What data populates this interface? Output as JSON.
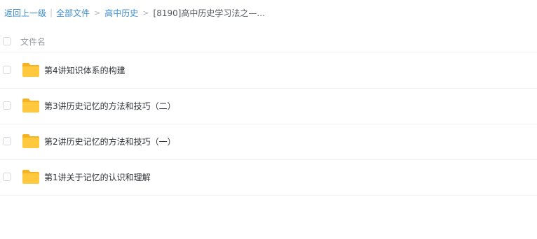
{
  "breadcrumb": {
    "back_label": "返回上一级",
    "separator": "|",
    "all_files_label": "全部文件",
    "arrow": ">",
    "level1_label": "高中历史",
    "current_label": "[8190]高中历史学习法之—..."
  },
  "table": {
    "column_name_header": "文件名",
    "rows": [
      {
        "name": "第4讲知识体系的构建",
        "icon": "folder-icon"
      },
      {
        "name": "第3讲历史记忆的方法和技巧（二）",
        "icon": "folder-icon"
      },
      {
        "name": "第2讲历史记忆的方法和技巧（一）",
        "icon": "folder-icon"
      },
      {
        "name": "第1讲关于记忆的认识和理解",
        "icon": "folder-icon"
      }
    ]
  },
  "colors": {
    "link": "#3b8cd1",
    "folder_body": "#ffc83d",
    "folder_tab": "#f5b324"
  }
}
